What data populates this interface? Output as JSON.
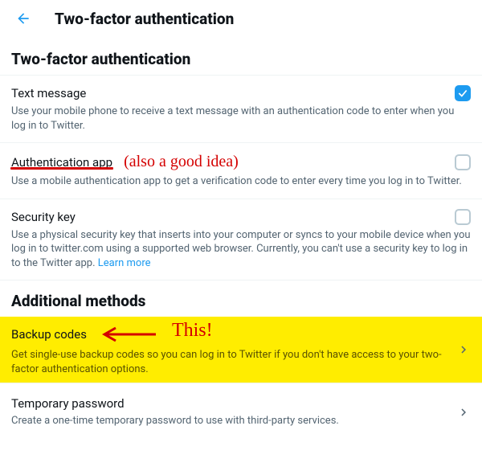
{
  "header": {
    "title": "Two-factor authentication"
  },
  "section1": {
    "heading": "Two-factor authentication"
  },
  "methods": {
    "text_message": {
      "title": "Text message",
      "desc": "Use your mobile phone to receive a text message with an authentication code to enter when you log in to Twitter.",
      "checked": true
    },
    "auth_app": {
      "title": "Authentication app",
      "desc": "Use a mobile authentication app to get a verification code to enter every time you log in to Twitter.",
      "checked": false,
      "annotation": "(also a good idea)"
    },
    "security_key": {
      "title": "Security key",
      "desc_part1": "Use a physical security key that inserts into your computer or syncs to your mobile device when you log in to twitter.com using a supported web browser. Currently, you can't use a security key to log in to the Twitter app. ",
      "learn_more": "Learn more",
      "checked": false
    }
  },
  "section2": {
    "heading": "Additional methods"
  },
  "additional": {
    "backup_codes": {
      "title": "Backup codes",
      "desc": "Get single-use backup codes so you can log in to Twitter if you don't have access to your two-factor authentication options.",
      "annotation": "This!"
    },
    "temp_password": {
      "title": "Temporary password",
      "desc": "Create a one-time temporary password to use with third-party services."
    }
  }
}
